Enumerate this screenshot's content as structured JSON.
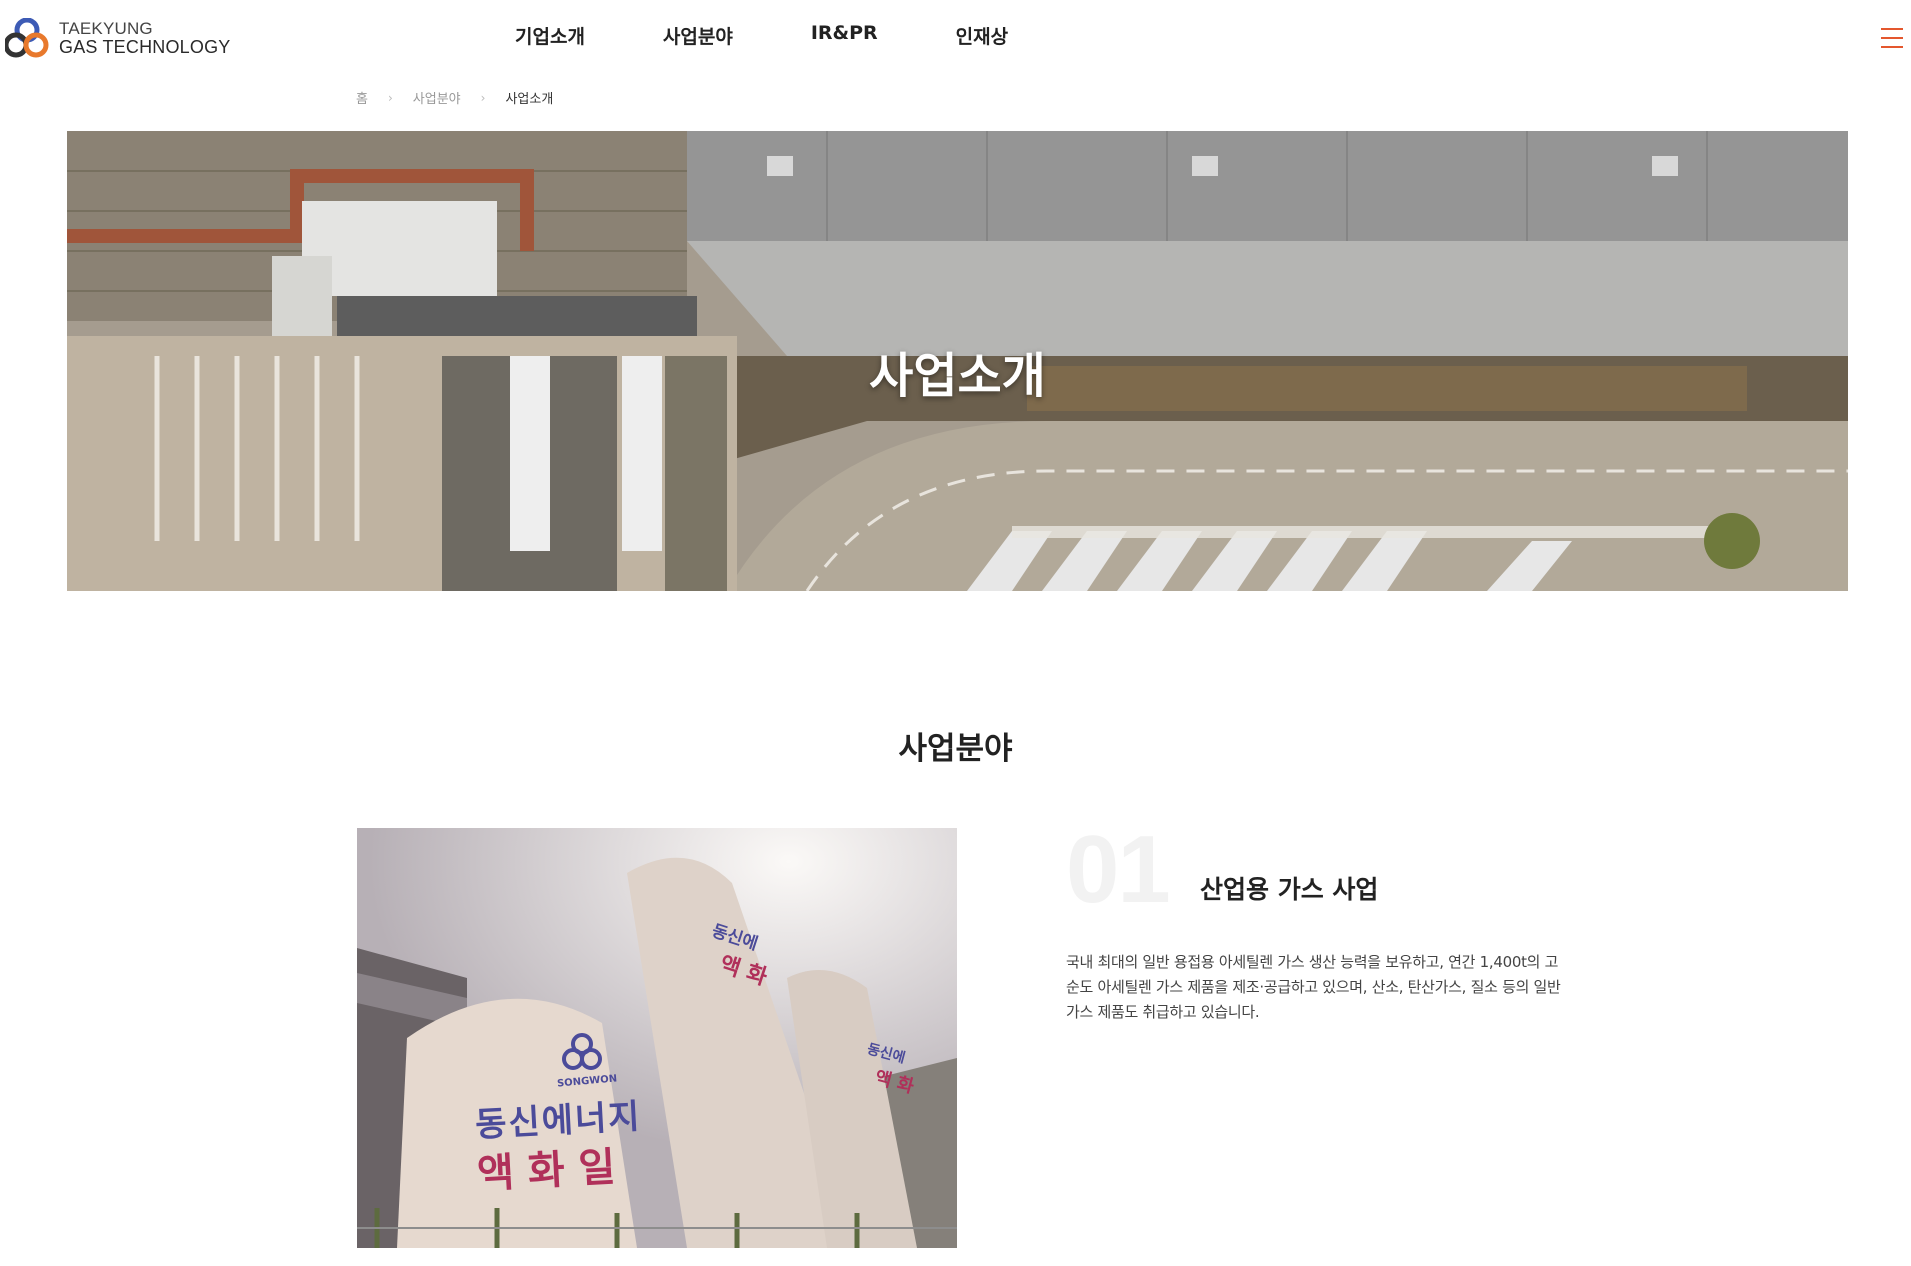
{
  "brand": {
    "line1": "TAEKYUNG",
    "line2": "GAS TECHNOLOGY",
    "colors": {
      "blue": "#3d5bb5",
      "orange": "#e8792c",
      "dark": "#333333"
    }
  },
  "nav": {
    "items": [
      {
        "label": "기업소개"
      },
      {
        "label": "사업분야"
      },
      {
        "label": "IR&PR"
      },
      {
        "label": "인재상"
      }
    ],
    "menu_icon": "hamburger-icon",
    "accent": "#e4572e"
  },
  "breadcrumb": {
    "home": "홈",
    "level1": "사업분야",
    "current": "사업소개"
  },
  "hero": {
    "title": "사업소개"
  },
  "section": {
    "title": "사업분야",
    "items": [
      {
        "number": "01",
        "title": "산업용 가스 사업",
        "description": "국내 최대의 일반 용접용 아세틸렌 가스 생산 능력을 보유하고, 연간 1,400t의 고순도 아세틸렌 가스 제품을 제조·공급하고 있으며, 산소, 탄산가스, 질소 등의 일반 가스 제품도 취급하고 있습니다.",
        "photo_text": {
          "brand": "SONGWON",
          "tank1_line1": "동신에너지",
          "tank1_line2": "액 화 일",
          "tank2_line1": "동신에",
          "tank2_line2": "액 화",
          "tank3_line1": "동신에",
          "tank3_line2": "액 화"
        }
      }
    ]
  }
}
